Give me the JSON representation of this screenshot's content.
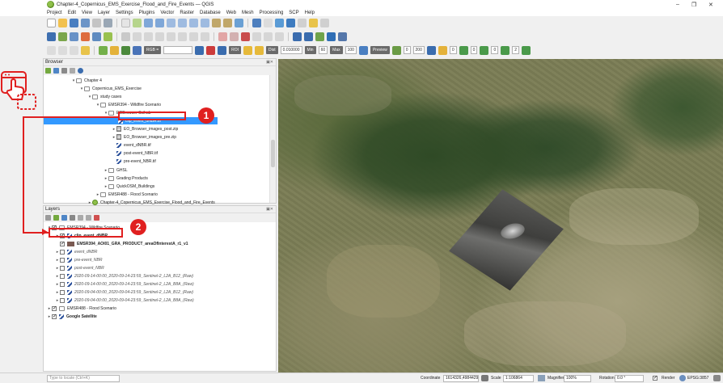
{
  "window": {
    "title": "Chapter-4_Copernicus_EMS_Exercise_Flood_and_Fire_Events — QGIS",
    "controls": [
      "–",
      "❐",
      "✕"
    ]
  },
  "menu": [
    "Project",
    "Edit",
    "View",
    "Layer",
    "Settings",
    "Plugins",
    "Vector",
    "Raster",
    "Database",
    "Web",
    "Mesh",
    "Processing",
    "SCP",
    "Help"
  ],
  "toolbar3": {
    "rgb": "RGB =",
    "roi": "ROI",
    "dist": "Dist",
    "dist_val": "0.010000",
    "min": "Min",
    "min_val": "60",
    "max": "Max",
    "max_val": "100",
    "preview": "Preview",
    "v1": "0",
    "v2": "200",
    "v3": "0",
    "v4": "0",
    "v5": "0",
    "v6": "2"
  },
  "browser": {
    "title": "Browser",
    "items": [
      {
        "label": "Chapter 4"
      },
      {
        "label": "Copernicus_EMS_Exercise"
      },
      {
        "label": "study cases"
      },
      {
        "label": "EMSR394 - Wildfire Scenario"
      },
      {
        "label": "EOBrowser-Scihub"
      },
      {
        "label": "clip_event_dNBR.tif"
      },
      {
        "label": "EO_Browser_images_post.zip"
      },
      {
        "label": "EO_Browser_images_pre.zip"
      },
      {
        "label": "event_dNBR.tif"
      },
      {
        "label": "post-event_NBR.tif"
      },
      {
        "label": "pre-event_NBR.tif"
      },
      {
        "label": "GHSL"
      },
      {
        "label": "Grading Products"
      },
      {
        "label": "QuickOSM_Buildings"
      },
      {
        "label": "EMSR488 - Flood Scenario"
      },
      {
        "label": "Chapter-4_Copernicus_EMS_Exercise_Flood_and_Fire_Events"
      }
    ]
  },
  "layers": {
    "title": "Layers",
    "items": [
      {
        "label": "EMSR394 - Wildfire Scenario"
      },
      {
        "label": "clip_event_dNBR"
      },
      {
        "label": "EMSR394_AOI01_GRA_PRODUCT_areaOfInterestA_r1_v1"
      },
      {
        "label": "event_dNBR"
      },
      {
        "label": "pre-event_NBR"
      },
      {
        "label": "post-event_NBR"
      },
      {
        "label": "2020-09-14-00:00_2020-09-14-23:59_Sentinel-2_L2A_B12_(Raw)"
      },
      {
        "label": "2020-09-14-00:00_2020-09-14-23:59_Sentinel-2_L2A_B8A_(Raw)"
      },
      {
        "label": "2020-09-04-00:00_2020-09-04-23:59_Sentinel-2_L2A_B12_(Raw)"
      },
      {
        "label": "2020-09-04-00:00_2020-09-04-23:59_Sentinel-2_L2A_B8A_(Raw)"
      },
      {
        "label": "EMSR488 - Flood Scenario"
      },
      {
        "label": "Google Satellite"
      }
    ]
  },
  "annotations": {
    "badge1": "1",
    "badge2": "2"
  },
  "status": {
    "locate_placeholder": "Type to locate (Ctrl+K)",
    "coordinate_label": "Coordinate",
    "coordinate_value": "1614326,4984429",
    "scale_label": "Scale",
    "scale_value": "1:106864",
    "magnifier_label": "Magnifier",
    "magnifier_value": "100%",
    "rotation_label": "Rotation",
    "rotation_value": "0.0 °",
    "render_label": "Render",
    "crs": "EPSG:3857"
  }
}
